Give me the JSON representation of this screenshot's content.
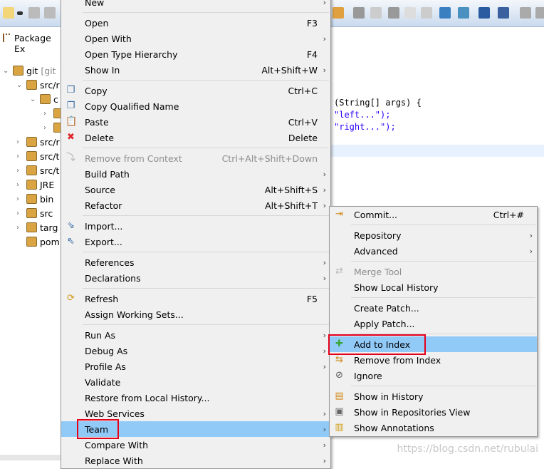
{
  "toolbar": {
    "icons": [
      "new-wizard-icon",
      "dropdown-icon",
      "save-icon",
      "save-all-icon",
      "open-folder-icon",
      "search-icon",
      "brush-icon",
      "people-icon",
      "document-icon",
      "paragraph-icon",
      "globe-icon",
      "run-server-icon",
      "monitor-icon",
      "no-debug-icon",
      "resume-icon",
      "suspend-icon"
    ]
  },
  "package_explorer": {
    "title": "Package Ex",
    "tree": [
      {
        "label": "git",
        "suffix": "[git",
        "indent": 0,
        "chev": "v"
      },
      {
        "label": "src/r",
        "indent": 1,
        "chev": "v"
      },
      {
        "label": "c",
        "indent": 2,
        "chev": "v"
      },
      {
        "label": "",
        "indent": 3,
        "chev": ">"
      },
      {
        "label": "",
        "indent": 3,
        "chev": ">"
      },
      {
        "label": "src/r",
        "indent": 1,
        "chev": ">"
      },
      {
        "label": "src/t",
        "indent": 1,
        "chev": ">"
      },
      {
        "label": "src/t",
        "indent": 1,
        "chev": ">"
      },
      {
        "label": "JRE",
        "indent": 1,
        "chev": ">"
      },
      {
        "label": "bin",
        "indent": 1,
        "chev": ">"
      },
      {
        "label": "src",
        "indent": 1,
        "chev": ">"
      },
      {
        "label": "targ",
        "indent": 1,
        "chev": ">"
      },
      {
        "label": "pom",
        "indent": 1,
        "chev": ""
      }
    ]
  },
  "editor": {
    "lines": [
      {
        "text": "(String[] args) {",
        "color": "#000"
      },
      {
        "text": "\"left...\");",
        "color": "#2a00ff"
      },
      {
        "text": "\"right...\");",
        "color": "#2a00ff"
      }
    ]
  },
  "context_menu": {
    "items": [
      {
        "label": "New",
        "arrow": true
      },
      {
        "sep": true
      },
      {
        "label": "Open",
        "accel": "F3"
      },
      {
        "label": "Open With",
        "arrow": true
      },
      {
        "label": "Open Type Hierarchy",
        "accel": "F4"
      },
      {
        "label": "Show In",
        "accel": "Alt+Shift+W",
        "arrow": true
      },
      {
        "sep": true
      },
      {
        "label": "Copy",
        "accel": "Ctrl+C",
        "icon": "copy-icon",
        "glyph": "❐",
        "color": "#3a6ea5"
      },
      {
        "label": "Copy Qualified Name",
        "icon": "copy-qualified-name-icon",
        "glyph": "❐",
        "color": "#3a6ea5"
      },
      {
        "label": "Paste",
        "accel": "Ctrl+V",
        "icon": "paste-icon",
        "glyph": "📋",
        "color": "#b07a2a"
      },
      {
        "label": "Delete",
        "accel": "Delete",
        "icon": "delete-icon",
        "glyph": "✖",
        "color": "#e0252a"
      },
      {
        "sep": true
      },
      {
        "label": "Remove from Context",
        "accel": "Ctrl+Alt+Shift+Down",
        "disabled": true,
        "icon": "remove-context-icon",
        "glyph": "⤵",
        "color": "#aaa"
      },
      {
        "label": "Build Path",
        "arrow": true
      },
      {
        "label": "Source",
        "accel": "Alt+Shift+S",
        "arrow": true
      },
      {
        "label": "Refactor",
        "accel": "Alt+Shift+T",
        "arrow": true
      },
      {
        "sep": true
      },
      {
        "label": "Import...",
        "icon": "import-icon",
        "glyph": "⇘",
        "color": "#3a6ea5"
      },
      {
        "label": "Export...",
        "icon": "export-icon",
        "glyph": "⇖",
        "color": "#3a6ea5"
      },
      {
        "sep": true
      },
      {
        "label": "References",
        "arrow": true
      },
      {
        "label": "Declarations",
        "arrow": true
      },
      {
        "sep": true
      },
      {
        "label": "Refresh",
        "accel": "F5",
        "icon": "refresh-icon",
        "glyph": "⟳",
        "color": "#d39a1a"
      },
      {
        "label": "Assign Working Sets..."
      },
      {
        "sep": true
      },
      {
        "label": "Run As",
        "arrow": true
      },
      {
        "label": "Debug As",
        "arrow": true
      },
      {
        "label": "Profile As",
        "arrow": true
      },
      {
        "label": "Validate"
      },
      {
        "label": "Restore from Local History..."
      },
      {
        "label": "Web Services",
        "arrow": true
      },
      {
        "label": "Team",
        "arrow": true,
        "highlight": true
      },
      {
        "label": "Compare With",
        "arrow": true
      },
      {
        "label": "Replace With",
        "arrow": true
      }
    ]
  },
  "team_submenu": {
    "items": [
      {
        "label": "Commit...",
        "accel": "Ctrl+#",
        "icon": "commit-icon",
        "glyph": "⇥",
        "color": "#d08a1a"
      },
      {
        "sep": true
      },
      {
        "label": "Repository",
        "arrow": true
      },
      {
        "label": "Advanced",
        "arrow": true
      },
      {
        "sep": true
      },
      {
        "label": "Merge Tool",
        "disabled": true,
        "icon": "merge-tool-icon",
        "glyph": "⇄",
        "color": "#bbb"
      },
      {
        "label": "Show Local History"
      },
      {
        "sep": true
      },
      {
        "label": "Create Patch..."
      },
      {
        "label": "Apply Patch..."
      },
      {
        "sep": true
      },
      {
        "label": "Add to Index",
        "highlight": true,
        "icon": "add-icon",
        "glyph": "✚",
        "color": "#3aa53a"
      },
      {
        "label": "Remove from Index",
        "icon": "remove-from-index-icon",
        "glyph": "⇆",
        "color": "#d08a1a"
      },
      {
        "label": "Ignore",
        "icon": "ignore-icon",
        "glyph": "⊘",
        "color": "#555"
      },
      {
        "sep": true
      },
      {
        "label": "Show in History",
        "icon": "history-icon",
        "glyph": "▤",
        "color": "#d08a1a"
      },
      {
        "label": "Show in Repositories View",
        "icon": "git-repo-icon",
        "glyph": "▣",
        "color": "#666"
      },
      {
        "label": "Show Annotations",
        "icon": "annotations-icon",
        "glyph": "▥",
        "color": "#d0a01a"
      }
    ]
  },
  "watermark": "https://blog.csdn.net/rubulai",
  "colors": {
    "highlight": "#91c9f7",
    "callout": "#e5001a",
    "string": "#2a00ff"
  }
}
